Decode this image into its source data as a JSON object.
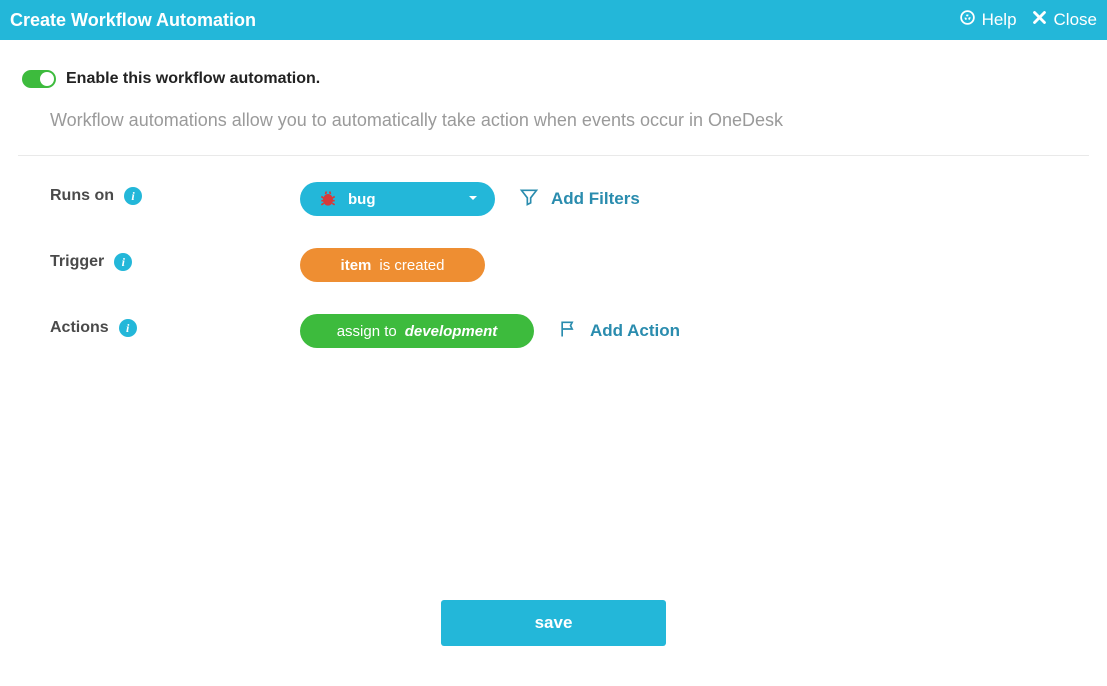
{
  "titlebar": {
    "title": "Create Workflow Automation",
    "help": "Help",
    "close": "Close"
  },
  "enable": {
    "label": "Enable this workflow automation.",
    "on": true
  },
  "description": "Workflow automations allow you to automatically take action when events occur in OneDesk",
  "rows": {
    "runs_on": {
      "label": "Runs on",
      "value": "bug",
      "add_filters": "Add Filters"
    },
    "trigger": {
      "label": "Trigger",
      "item": "item",
      "event": "is created"
    },
    "actions": {
      "label": "Actions",
      "action": "assign to",
      "target": "development",
      "add_action": "Add Action"
    }
  },
  "footer": {
    "save": "save"
  }
}
